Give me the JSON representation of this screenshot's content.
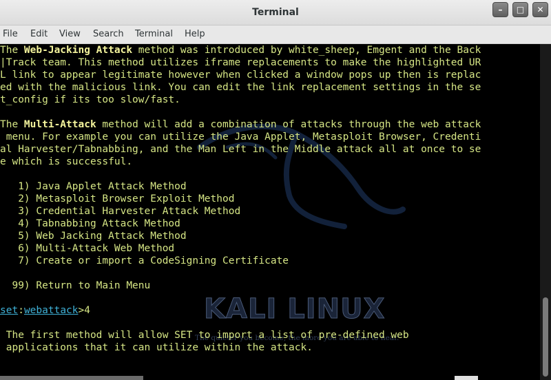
{
  "window": {
    "title": "Terminal"
  },
  "window_buttons": {
    "minimize": "–",
    "maximize": "□",
    "close": "✕"
  },
  "menu": [
    "File",
    "Edit",
    "View",
    "Search",
    "Terminal",
    "Help"
  ],
  "terminal": {
    "p1": {
      "l1_pre": "The ",
      "l1_bold": "Web-Jacking Attack",
      "l1_post": " method was introduced by white_sheep, Emgent and the Back",
      "l2": "|Track team. This method utilizes iframe replacements to make the highlighted UR",
      "l3": "L link to appear legitimate however when clicked a window pops up then is replac",
      "l4": "ed with the malicious link. You can edit the link replacement settings in the se",
      "l5": "t_config if its too slow/fast."
    },
    "p2": {
      "l1_pre": "The ",
      "l1_bold": "Multi-Attack",
      "l1_post": " method will add a combination of attacks through the web attack",
      "l2": " menu. For example you can utilize the Java Applet, Metasploit Browser, Credenti",
      "l3": "al Harvester/Tabnabbing, and the Man Left in the Middle attack all at once to se",
      "l4": "e which is successful."
    },
    "options": [
      "   1) Java Applet Attack Method",
      "   2) Metasploit Browser Exploit Method",
      "   3) Credential Harvester Attack Method",
      "   4) Tabnabbing Attack Method",
      "   5) Web Jacking Attack Method",
      "   6) Multi-Attack Web Method",
      "   7) Create or import a CodeSigning Certificate"
    ],
    "return_option": "  99) Return to Main Menu",
    "prompt": {
      "set": "set",
      "sep": ":",
      "module": "webattack",
      "input": ">4"
    },
    "output": [
      " The first method will allow SET to import a list of pre-defined web",
      " applications that it can utilize within the attack."
    ]
  },
  "wallpaper": {
    "logo": "KALI LINUX",
    "tagline": "The quieter you become, the more you are able to hear."
  }
}
